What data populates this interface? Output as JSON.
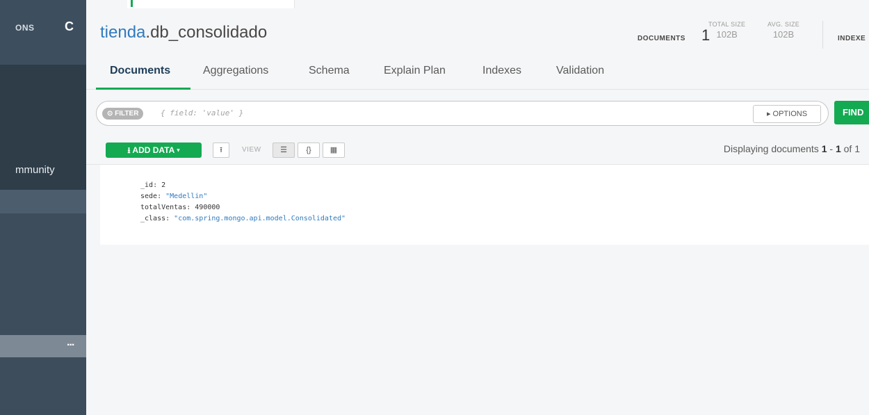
{
  "sidebar": {
    "section_label": "ONS",
    "refresh_icon_char": "C",
    "community_label": "mmunity",
    "selected_dots": "..."
  },
  "collection": {
    "db": "tienda",
    "separator": ".",
    "name": "db_consolidado"
  },
  "stats": {
    "documents_label": "DOCUMENTS",
    "documents_value": "1",
    "total_size_label": "TOTAL SIZE",
    "total_size_value": "102B",
    "avg_size_label": "AVG. SIZE",
    "avg_size_value": "102B",
    "indexes_label": "INDEXE"
  },
  "tabs": [
    {
      "label": "Documents",
      "active": true
    },
    {
      "label": "Aggregations"
    },
    {
      "label": "Schema"
    },
    {
      "label": "Explain Plan"
    },
    {
      "label": "Indexes"
    },
    {
      "label": "Validation"
    }
  ],
  "filter": {
    "pill_label": "FILTER",
    "placeholder": "{ field: 'value' }",
    "options_label": "▸ OPTIONS",
    "find_label": "FIND"
  },
  "toolbar": {
    "add_data_label": "ADD DATA",
    "view_label": "VIEW",
    "json_view_glyph": "{}",
    "displaying_prefix": "Displaying documents ",
    "displaying_from": "1",
    "displaying_mid": " - ",
    "displaying_to": "1",
    "displaying_suffix": " of 1"
  },
  "document": {
    "fields": [
      {
        "key": "_id",
        "value": "2",
        "type": "number"
      },
      {
        "key": "sede",
        "value": "\"Medellin\"",
        "type": "string"
      },
      {
        "key": "totalVentas",
        "value": "490000",
        "type": "number"
      },
      {
        "key": "_class",
        "value": "\"com.spring.mongo.api.model.Consolidated\"",
        "type": "string"
      }
    ]
  },
  "colors": {
    "accent_green": "#13aa52",
    "sidebar_bg": "#3e4d5b",
    "link_blue": "#2f7bbf"
  }
}
